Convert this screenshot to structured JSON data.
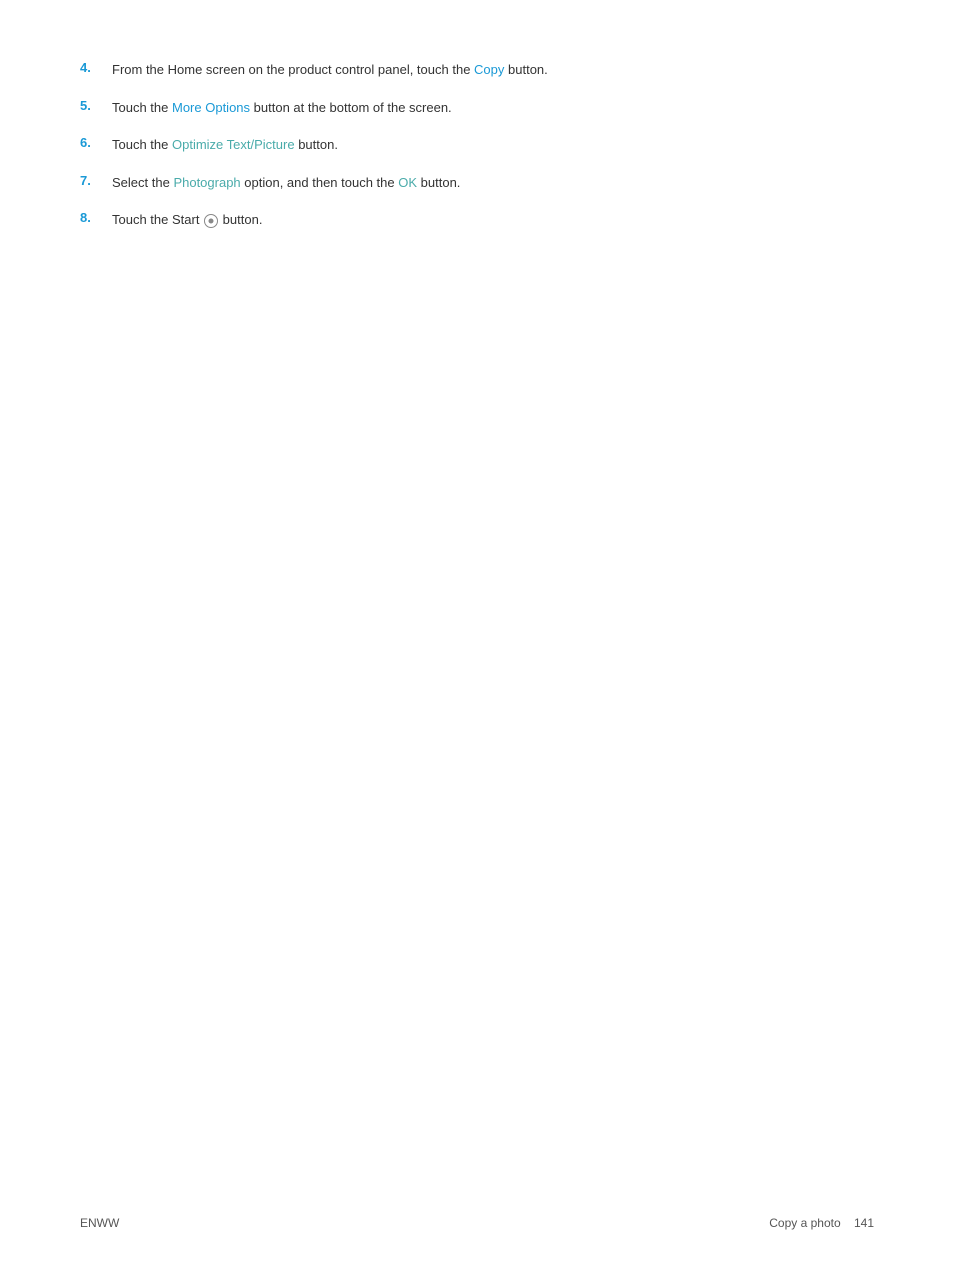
{
  "steps": [
    {
      "number": "4.",
      "text_parts": [
        {
          "text": "From the Home screen on the product control panel, touch the ",
          "type": "normal"
        },
        {
          "text": "Copy",
          "type": "link-blue"
        },
        {
          "text": " button.",
          "type": "normal"
        }
      ]
    },
    {
      "number": "5.",
      "text_parts": [
        {
          "text": "Touch the ",
          "type": "normal"
        },
        {
          "text": "More Options",
          "type": "link-blue"
        },
        {
          "text": " button at the bottom of the screen.",
          "type": "normal"
        }
      ]
    },
    {
      "number": "6.",
      "text_parts": [
        {
          "text": "Touch the ",
          "type": "normal"
        },
        {
          "text": "Optimize Text/Picture",
          "type": "link-teal"
        },
        {
          "text": " button.",
          "type": "normal"
        }
      ]
    },
    {
      "number": "7.",
      "text_parts": [
        {
          "text": "Select the ",
          "type": "normal"
        },
        {
          "text": "Photograph",
          "type": "link-teal"
        },
        {
          "text": " option, and then touch the ",
          "type": "normal"
        },
        {
          "text": "OK",
          "type": "link-teal"
        },
        {
          "text": " button.",
          "type": "normal"
        }
      ]
    },
    {
      "number": "8.",
      "text_parts": [
        {
          "text": "Touch the Start ",
          "type": "normal"
        },
        {
          "text": "ICON",
          "type": "icon"
        },
        {
          "text": " button.",
          "type": "normal"
        }
      ]
    }
  ],
  "footer": {
    "left": "ENWW",
    "right": "Copy a photo",
    "page": "141"
  }
}
